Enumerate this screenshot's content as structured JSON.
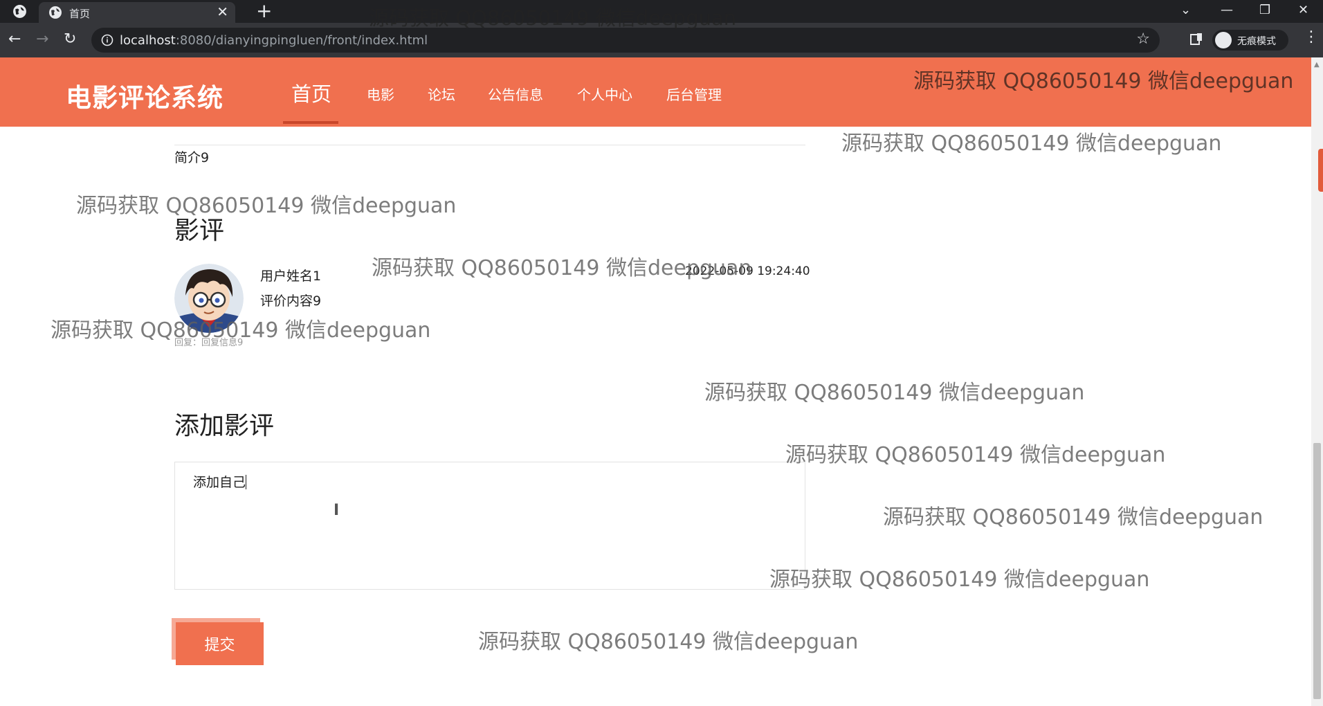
{
  "browser": {
    "tab_title": "首页",
    "url_host": "localhost",
    "url_rest": ":8080/dianyingpingluen/front/index.html",
    "incognito_label": "无痕模式"
  },
  "site": {
    "title": "电影评论系统",
    "nav": [
      "首页",
      "电影",
      "论坛",
      "公告信息",
      "个人中心",
      "后台管理"
    ],
    "active_nav": "首页",
    "accent_color": "#f0704f"
  },
  "movie": {
    "intro": "简介9"
  },
  "reviews": {
    "heading": "影评",
    "items": [
      {
        "user": "用户姓名1",
        "content": "评价内容9",
        "time": "2022-05-09 19:24:40",
        "reply": "回复：回复信息9"
      }
    ]
  },
  "add_review": {
    "heading": "添加影评",
    "input_value": "添加自己",
    "submit_label": "提交"
  },
  "watermark": {
    "text": "源码获取 QQ86050149 微信deepguan"
  }
}
